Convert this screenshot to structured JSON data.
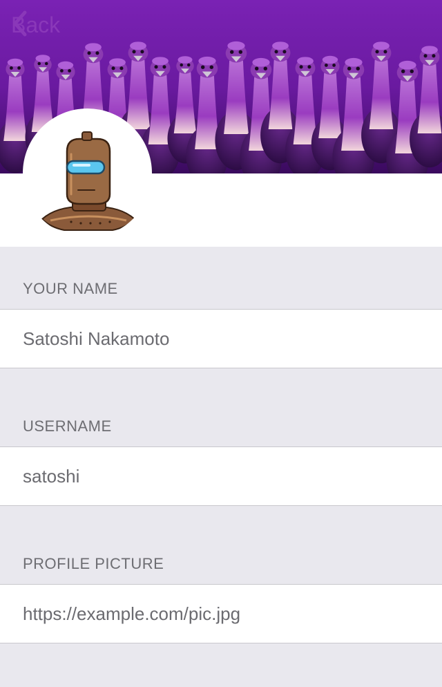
{
  "nav": {
    "back_label": "Back"
  },
  "banner": {
    "image": "purple-ostriches-crowd"
  },
  "avatar": {
    "image": "robot-diver-helmet-avatar"
  },
  "form": {
    "name": {
      "header": "YOUR NAME",
      "value": "Satoshi Nakamoto"
    },
    "username": {
      "header": "USERNAME",
      "value": "satoshi"
    },
    "picture": {
      "header": "PROFILE PICTURE",
      "value": "https://example.com/pic.jpg"
    }
  },
  "colors": {
    "accent": "#8a38b9",
    "group_background": "#e9e8ee",
    "header_text": "#6d6d72",
    "field_text": "#6b6b70"
  }
}
